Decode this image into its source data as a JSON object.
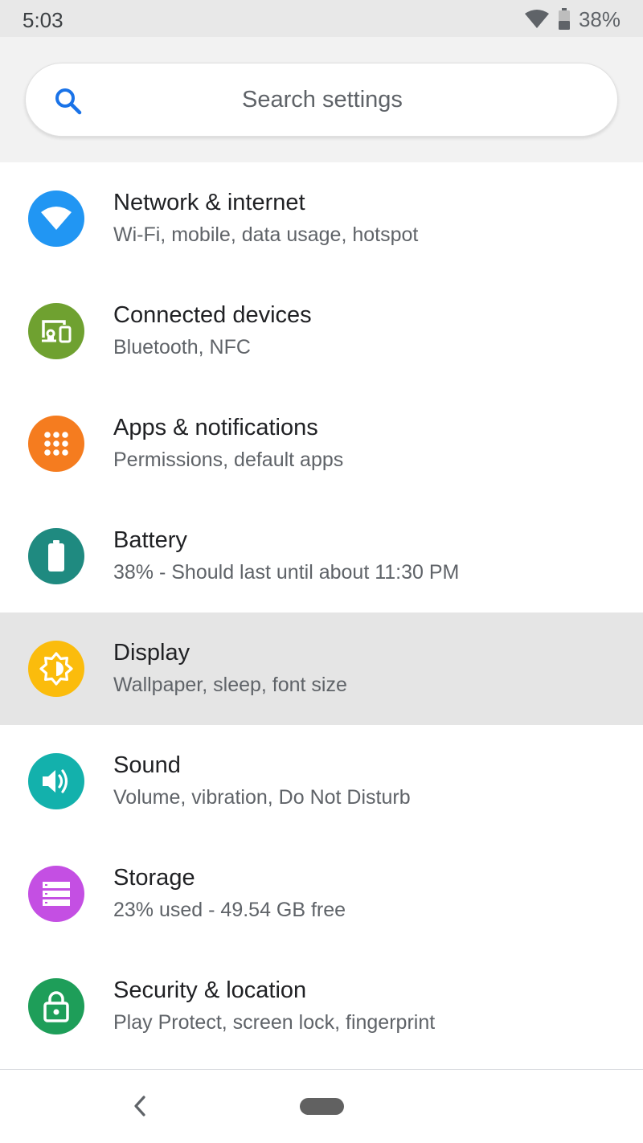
{
  "status_bar": {
    "time": "5:03",
    "battery_percent": "38%",
    "icons": [
      "wifi-icon",
      "battery-icon"
    ]
  },
  "search": {
    "placeholder": "Search settings",
    "value": ""
  },
  "settings": [
    {
      "title": "Network & internet",
      "subtitle": "Wi-Fi, mobile, data usage, hotspot",
      "icon": "wifi-icon",
      "color": "#2196f3"
    },
    {
      "title": "Connected devices",
      "subtitle": "Bluetooth, NFC",
      "icon": "devices-icon",
      "color": "#6fa130"
    },
    {
      "title": "Apps & notifications",
      "subtitle": "Permissions, default apps",
      "icon": "apps-grid-icon",
      "color": "#f57c1f"
    },
    {
      "title": "Battery",
      "subtitle": "38% - Should last until about 11:30 PM",
      "icon": "battery-icon",
      "color": "#1f8a80"
    },
    {
      "title": "Display",
      "subtitle": "Wallpaper, sleep, font size",
      "icon": "brightness-icon",
      "color": "#fbbc0c",
      "selected": true
    },
    {
      "title": "Sound",
      "subtitle": "Volume, vibration, Do Not Disturb",
      "icon": "volume-icon",
      "color": "#13b1ac"
    },
    {
      "title": "Storage",
      "subtitle": "23% used - 49.54 GB free",
      "icon": "storage-icon",
      "color": "#c44fe3"
    },
    {
      "title": "Security & location",
      "subtitle": "Play Protect, screen lock, fingerprint",
      "icon": "lock-icon",
      "color": "#1e9e59"
    }
  ],
  "colors": {
    "accent": "#1a73e8",
    "selected_row": "#e5e5e5",
    "search_background": "#f2f2f2",
    "status_bar": "#e8e8e8"
  }
}
